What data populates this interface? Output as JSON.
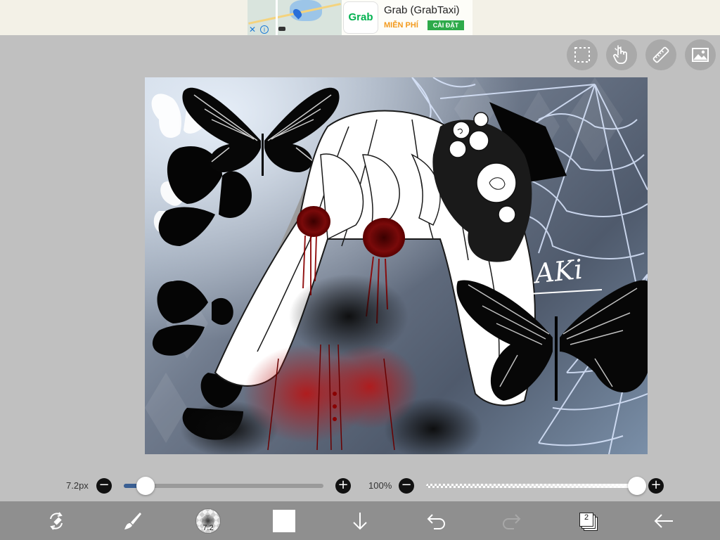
{
  "ad": {
    "title": "Grab (GrabTaxi)",
    "logo_text": "Grab",
    "free_label": "MIỄN PHÍ",
    "install_label": "CÀI ĐẶT",
    "close_glyph": "✕",
    "info_glyph": "i"
  },
  "top_tools": [
    {
      "icon": "selection-icon"
    },
    {
      "icon": "hand-icon"
    },
    {
      "icon": "ruler-icon"
    },
    {
      "icon": "image-icon"
    }
  ],
  "canvas": {
    "signature": "AKi",
    "colors": {
      "background_light": "#b8c6d6",
      "background_dark": "#4f5a6c",
      "blood": "#b01818",
      "black": "#0a0a0a",
      "white": "#ffffff"
    }
  },
  "brush": {
    "size_label": "7.2px",
    "size_value": 0.11,
    "opacity_label": "100%",
    "opacity_value": 1.0,
    "minus_glyph": "−",
    "plus_glyph": "+"
  },
  "bottom_toolbar": {
    "brush_size_text": "7.2",
    "layer_count": "2",
    "color": "#ffffff",
    "items": [
      "swap-tool-icon",
      "brush-icon",
      "brush-preview",
      "color-swatch",
      "download-icon",
      "undo-icon",
      "redo-icon",
      "layers-icon",
      "back-icon"
    ]
  }
}
